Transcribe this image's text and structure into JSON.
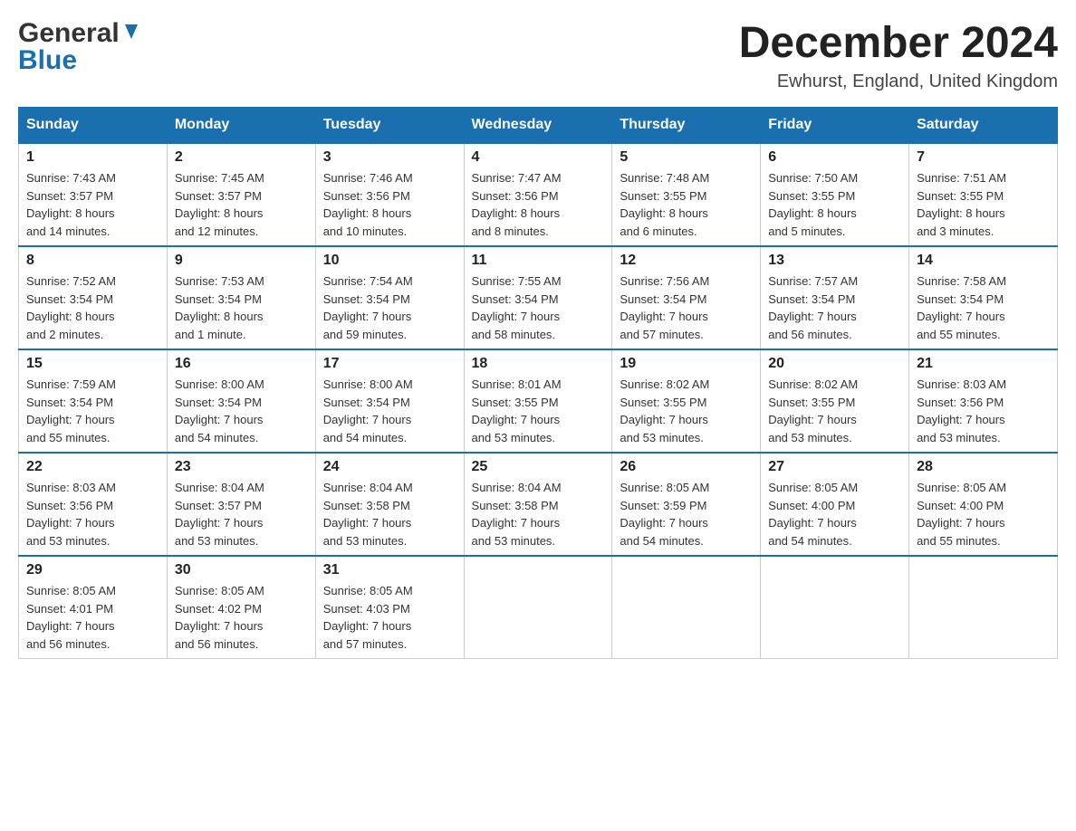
{
  "logo": {
    "general": "General",
    "blue": "Blue"
  },
  "header": {
    "title": "December 2024",
    "location": "Ewhurst, England, United Kingdom"
  },
  "days_of_week": [
    "Sunday",
    "Monday",
    "Tuesday",
    "Wednesday",
    "Thursday",
    "Friday",
    "Saturday"
  ],
  "weeks": [
    [
      {
        "day": "1",
        "sunrise": "7:43 AM",
        "sunset": "3:57 PM",
        "daylight": "8 hours and 14 minutes."
      },
      {
        "day": "2",
        "sunrise": "7:45 AM",
        "sunset": "3:57 PM",
        "daylight": "8 hours and 12 minutes."
      },
      {
        "day": "3",
        "sunrise": "7:46 AM",
        "sunset": "3:56 PM",
        "daylight": "8 hours and 10 minutes."
      },
      {
        "day": "4",
        "sunrise": "7:47 AM",
        "sunset": "3:56 PM",
        "daylight": "8 hours and 8 minutes."
      },
      {
        "day": "5",
        "sunrise": "7:48 AM",
        "sunset": "3:55 PM",
        "daylight": "8 hours and 6 minutes."
      },
      {
        "day": "6",
        "sunrise": "7:50 AM",
        "sunset": "3:55 PM",
        "daylight": "8 hours and 5 minutes."
      },
      {
        "day": "7",
        "sunrise": "7:51 AM",
        "sunset": "3:55 PM",
        "daylight": "8 hours and 3 minutes."
      }
    ],
    [
      {
        "day": "8",
        "sunrise": "7:52 AM",
        "sunset": "3:54 PM",
        "daylight": "8 hours and 2 minutes."
      },
      {
        "day": "9",
        "sunrise": "7:53 AM",
        "sunset": "3:54 PM",
        "daylight": "8 hours and 1 minute."
      },
      {
        "day": "10",
        "sunrise": "7:54 AM",
        "sunset": "3:54 PM",
        "daylight": "7 hours and 59 minutes."
      },
      {
        "day": "11",
        "sunrise": "7:55 AM",
        "sunset": "3:54 PM",
        "daylight": "7 hours and 58 minutes."
      },
      {
        "day": "12",
        "sunrise": "7:56 AM",
        "sunset": "3:54 PM",
        "daylight": "7 hours and 57 minutes."
      },
      {
        "day": "13",
        "sunrise": "7:57 AM",
        "sunset": "3:54 PM",
        "daylight": "7 hours and 56 minutes."
      },
      {
        "day": "14",
        "sunrise": "7:58 AM",
        "sunset": "3:54 PM",
        "daylight": "7 hours and 55 minutes."
      }
    ],
    [
      {
        "day": "15",
        "sunrise": "7:59 AM",
        "sunset": "3:54 PM",
        "daylight": "7 hours and 55 minutes."
      },
      {
        "day": "16",
        "sunrise": "8:00 AM",
        "sunset": "3:54 PM",
        "daylight": "7 hours and 54 minutes."
      },
      {
        "day": "17",
        "sunrise": "8:00 AM",
        "sunset": "3:54 PM",
        "daylight": "7 hours and 54 minutes."
      },
      {
        "day": "18",
        "sunrise": "8:01 AM",
        "sunset": "3:55 PM",
        "daylight": "7 hours and 53 minutes."
      },
      {
        "day": "19",
        "sunrise": "8:02 AM",
        "sunset": "3:55 PM",
        "daylight": "7 hours and 53 minutes."
      },
      {
        "day": "20",
        "sunrise": "8:02 AM",
        "sunset": "3:55 PM",
        "daylight": "7 hours and 53 minutes."
      },
      {
        "day": "21",
        "sunrise": "8:03 AM",
        "sunset": "3:56 PM",
        "daylight": "7 hours and 53 minutes."
      }
    ],
    [
      {
        "day": "22",
        "sunrise": "8:03 AM",
        "sunset": "3:56 PM",
        "daylight": "7 hours and 53 minutes."
      },
      {
        "day": "23",
        "sunrise": "8:04 AM",
        "sunset": "3:57 PM",
        "daylight": "7 hours and 53 minutes."
      },
      {
        "day": "24",
        "sunrise": "8:04 AM",
        "sunset": "3:58 PM",
        "daylight": "7 hours and 53 minutes."
      },
      {
        "day": "25",
        "sunrise": "8:04 AM",
        "sunset": "3:58 PM",
        "daylight": "7 hours and 53 minutes."
      },
      {
        "day": "26",
        "sunrise": "8:05 AM",
        "sunset": "3:59 PM",
        "daylight": "7 hours and 54 minutes."
      },
      {
        "day": "27",
        "sunrise": "8:05 AM",
        "sunset": "4:00 PM",
        "daylight": "7 hours and 54 minutes."
      },
      {
        "day": "28",
        "sunrise": "8:05 AM",
        "sunset": "4:00 PM",
        "daylight": "7 hours and 55 minutes."
      }
    ],
    [
      {
        "day": "29",
        "sunrise": "8:05 AM",
        "sunset": "4:01 PM",
        "daylight": "7 hours and 56 minutes."
      },
      {
        "day": "30",
        "sunrise": "8:05 AM",
        "sunset": "4:02 PM",
        "daylight": "7 hours and 56 minutes."
      },
      {
        "day": "31",
        "sunrise": "8:05 AM",
        "sunset": "4:03 PM",
        "daylight": "7 hours and 57 minutes."
      },
      null,
      null,
      null,
      null
    ]
  ],
  "labels": {
    "sunrise": "Sunrise:",
    "sunset": "Sunset:",
    "daylight": "Daylight:"
  }
}
